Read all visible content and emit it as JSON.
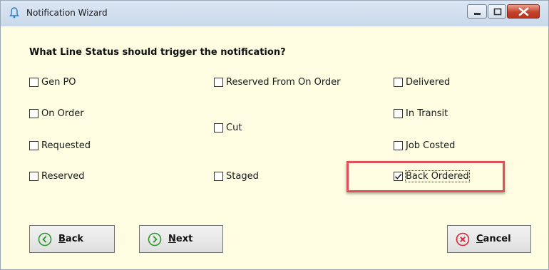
{
  "window": {
    "title": "Notification Wizard",
    "icon": "bell-icon",
    "controls": [
      "minimize-icon",
      "maximize-icon",
      "close-icon"
    ]
  },
  "question": "What Line Status should trigger the notification?",
  "checkboxes": [
    {
      "label": "Gen PO",
      "checked": false
    },
    {
      "label": "On Order",
      "checked": false
    },
    {
      "label": "Requested",
      "checked": false
    },
    {
      "label": "Reserved",
      "checked": false
    },
    {
      "label": "Reserved From On Order",
      "checked": false
    },
    {
      "label": "Cut",
      "checked": false
    },
    {
      "label": "Staged",
      "checked": false
    },
    {
      "label": "Delivered",
      "checked": false
    },
    {
      "label": "In Transit",
      "checked": false
    },
    {
      "label": "Job Costed",
      "checked": false
    },
    {
      "label": "Back Ordered",
      "checked": true
    }
  ],
  "buttons": {
    "back": {
      "accel": "B",
      "rest": "ack",
      "icon": "chevron-left-circle-icon"
    },
    "next": {
      "accel": "N",
      "rest": "ext",
      "icon": "chevron-right-circle-icon"
    },
    "cancel": {
      "accel": "C",
      "rest": "ancel",
      "icon": "x-circle-icon"
    }
  },
  "colors": {
    "background": "#fefde2",
    "accent_green": "#2e9a2e",
    "cancel_red": "#d8253a",
    "highlight": "#e0505a"
  }
}
